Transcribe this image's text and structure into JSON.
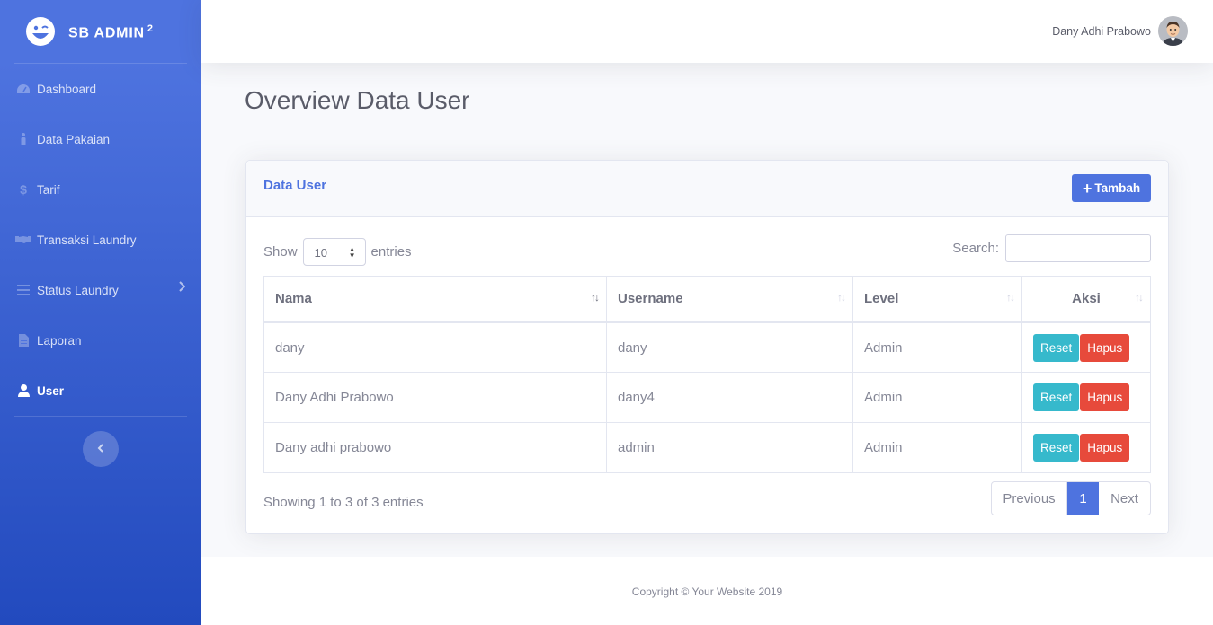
{
  "brand": {
    "name": "SB ADMIN",
    "sup": "2"
  },
  "sidebar": {
    "items": [
      {
        "label": "Dashboard",
        "icon": "tachometer-icon"
      },
      {
        "label": "Data Pakaian",
        "icon": "person-icon"
      },
      {
        "label": "Tarif",
        "icon": "dollar-icon"
      },
      {
        "label": "Transaksi Laundry",
        "icon": "handshake-icon"
      },
      {
        "label": "Status Laundry",
        "icon": "list-icon"
      },
      {
        "label": "Laporan",
        "icon": "file-icon"
      },
      {
        "label": "User",
        "icon": "user-icon"
      }
    ]
  },
  "topbar": {
    "user_name": "Dany Adhi Prabowo"
  },
  "page": {
    "title": "Overview Data User"
  },
  "card": {
    "title": "Data User",
    "add_label": "Tambah",
    "show_label": "Show",
    "entries_label": "entries",
    "page_size": "10",
    "search_label": "Search:",
    "search_value": "",
    "columns": [
      "Nama",
      "Username",
      "Level",
      "Aksi"
    ],
    "rows": [
      {
        "nama": "dany",
        "username": "dany",
        "level": "Admin"
      },
      {
        "nama": "Dany Adhi Prabowo",
        "username": "dany4",
        "level": "Admin"
      },
      {
        "nama": "Dany adhi prabowo",
        "username": "admin",
        "level": "Admin"
      }
    ],
    "reset_label": "Reset",
    "hapus_label": "Hapus",
    "info": "Showing 1 to 3 of 3 entries",
    "pager": {
      "prev": "Previous",
      "current": "1",
      "next": "Next"
    }
  },
  "footer": {
    "copyright": "Copyright © Your Website 2019"
  },
  "colors": {
    "primary": "#4e73df",
    "info": "#36b9cc",
    "danger": "#e74a3b"
  }
}
